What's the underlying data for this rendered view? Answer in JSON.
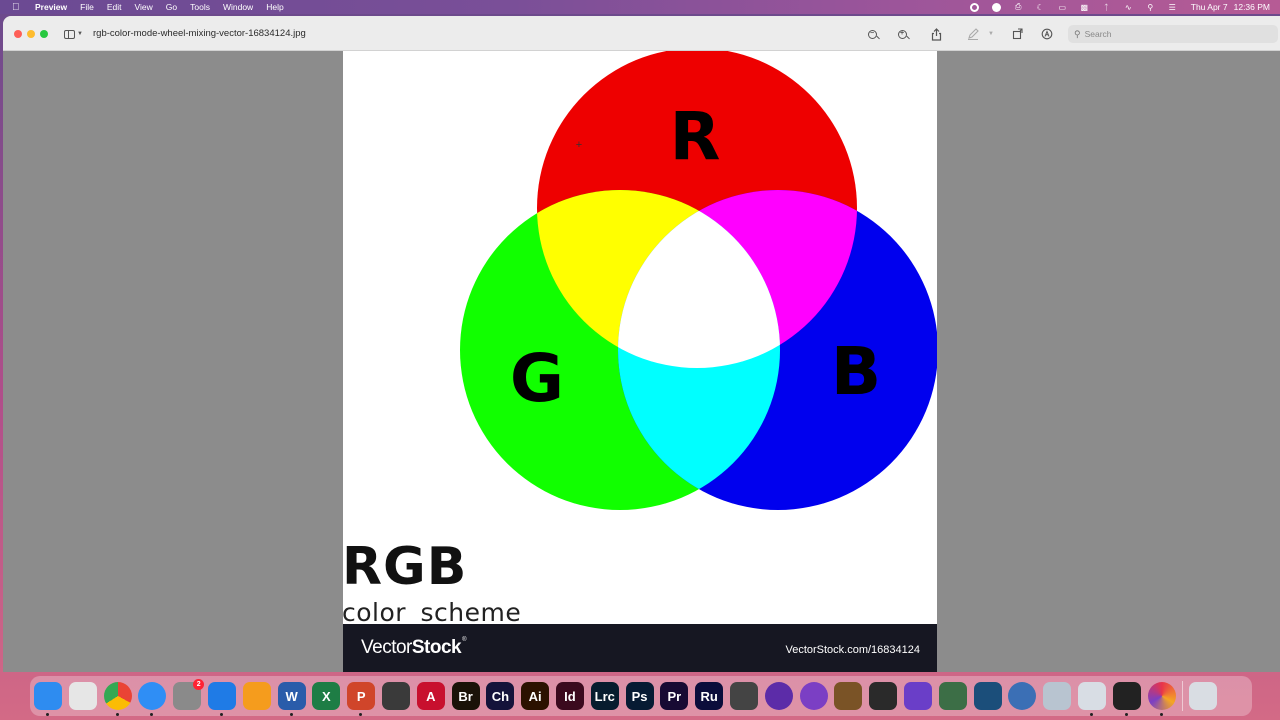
{
  "menubar": {
    "app_name": "Preview",
    "menus": [
      "File",
      "Edit",
      "View",
      "Go",
      "Tools",
      "Window",
      "Help"
    ],
    "clock_day": "Thu Apr 7",
    "clock_time": "12:36 PM"
  },
  "window": {
    "title": "rgb-color-mode-wheel-mixing-vector-16834124.jpg",
    "search_placeholder": "Search"
  },
  "image": {
    "letters": {
      "red": "R",
      "green": "G",
      "blue": "B"
    },
    "colors": {
      "red": "#ee0000",
      "green": "#11ff00",
      "blue": "#0000ee",
      "yellow": "#ffff00",
      "magenta": "#ff00ff",
      "cyan": "#00ffff",
      "white": "#ffffff"
    },
    "heading": "RGB",
    "subheading": "color  scheme",
    "footer_brand_light": "Vector",
    "footer_brand_bold": "Stock",
    "footer_registered": "®",
    "footer_url": "VectorStock.com/16834124"
  },
  "dock": {
    "apps": [
      {
        "name": "finder",
        "label": "",
        "color": "#2e8cf0"
      },
      {
        "name": "launchpad",
        "label": "",
        "color": "#e6e6e6"
      },
      {
        "name": "chrome",
        "label": "",
        "color": "#ffffff"
      },
      {
        "name": "safari",
        "label": "",
        "color": "#2f8ef5"
      },
      {
        "name": "system-preferences",
        "label": "",
        "color": "#8a8a8a",
        "badge": "2"
      },
      {
        "name": "keynote",
        "label": "",
        "color": "#1f7be6"
      },
      {
        "name": "pages",
        "label": "",
        "color": "#f59c1d"
      },
      {
        "name": "word",
        "label": "W",
        "color": "#2a5caa"
      },
      {
        "name": "excel",
        "label": "X",
        "color": "#1e7d45"
      },
      {
        "name": "powerpoint",
        "label": "P",
        "color": "#d0452a"
      },
      {
        "name": "davinci",
        "label": "",
        "color": "#3a3a3a"
      },
      {
        "name": "acrobat",
        "label": "A",
        "color": "#c8102e"
      },
      {
        "name": "bridge",
        "label": "Br",
        "color": "#1a1208"
      },
      {
        "name": "character-animator",
        "label": "Ch",
        "color": "#14133a"
      },
      {
        "name": "illustrator",
        "label": "Ai",
        "color": "#2b1100"
      },
      {
        "name": "indesign",
        "label": "Id",
        "color": "#3b0a1e"
      },
      {
        "name": "lightroom-classic",
        "label": "Lrc",
        "color": "#071c2e"
      },
      {
        "name": "photoshop",
        "label": "Ps",
        "color": "#071b33"
      },
      {
        "name": "premiere",
        "label": "Pr",
        "color": "#170a33"
      },
      {
        "name": "rush",
        "label": "Ru",
        "color": "#0b0d3b"
      },
      {
        "name": "compressor",
        "label": "",
        "color": "#444444"
      },
      {
        "name": "motion",
        "label": "",
        "color": "#5c2ca8"
      },
      {
        "name": "logic",
        "label": "",
        "color": "#7b3fc4"
      },
      {
        "name": "garageband",
        "label": "",
        "color": "#7a5326"
      },
      {
        "name": "final-cut",
        "label": "",
        "color": "#2a2a2a"
      },
      {
        "name": "imovie",
        "label": "",
        "color": "#6a3ec8"
      },
      {
        "name": "affinity",
        "label": "",
        "color": "#3c6e46"
      },
      {
        "name": "sketchup",
        "label": "",
        "color": "#1b4e7a"
      },
      {
        "name": "quicktime",
        "label": "",
        "color": "#3b6fb5"
      },
      {
        "name": "preview",
        "label": "",
        "color": "#b8c4d0"
      },
      {
        "name": "screen-capture",
        "label": "",
        "color": "#d8dde4"
      },
      {
        "name": "threads",
        "label": "",
        "color": "#222222"
      },
      {
        "name": "creative-cloud",
        "label": "",
        "color": "#e8344b"
      },
      {
        "name": "trash",
        "label": "",
        "color": "#d9dde3"
      }
    ]
  }
}
